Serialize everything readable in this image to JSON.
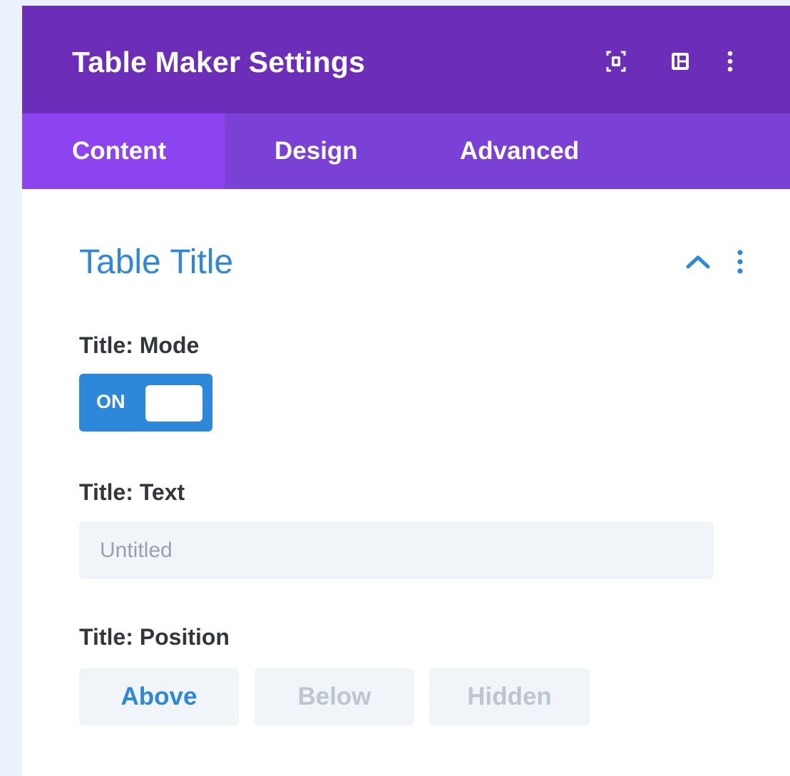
{
  "header": {
    "title": "Table Maker Settings",
    "icons": [
      "focus-icon",
      "sidebar-layout-icon",
      "more-vertical-icon"
    ]
  },
  "tabs": [
    {
      "label": "Content",
      "active": true
    },
    {
      "label": "Design",
      "active": false
    },
    {
      "label": "Advanced",
      "active": false
    }
  ],
  "section": {
    "title": "Table Title",
    "expanded": true,
    "icons": [
      "chevron-up-icon",
      "more-vertical-icon"
    ]
  },
  "fields": {
    "mode": {
      "label": "Title: Mode",
      "toggle_text": "ON",
      "value": true
    },
    "text": {
      "label": "Title: Text",
      "placeholder": "Untitled",
      "value": ""
    },
    "position": {
      "label": "Title: Position",
      "options": [
        "Above",
        "Below",
        "Hidden"
      ],
      "selected": "Above"
    }
  },
  "colors": {
    "header_bg": "#6c2eb9",
    "tabs_bg": "#7b40d5",
    "active_tab_bg": "#8b44f0",
    "accent_blue": "#2e88da",
    "input_bg": "#f1f5f9",
    "page_bg": "#eaf3fc"
  }
}
